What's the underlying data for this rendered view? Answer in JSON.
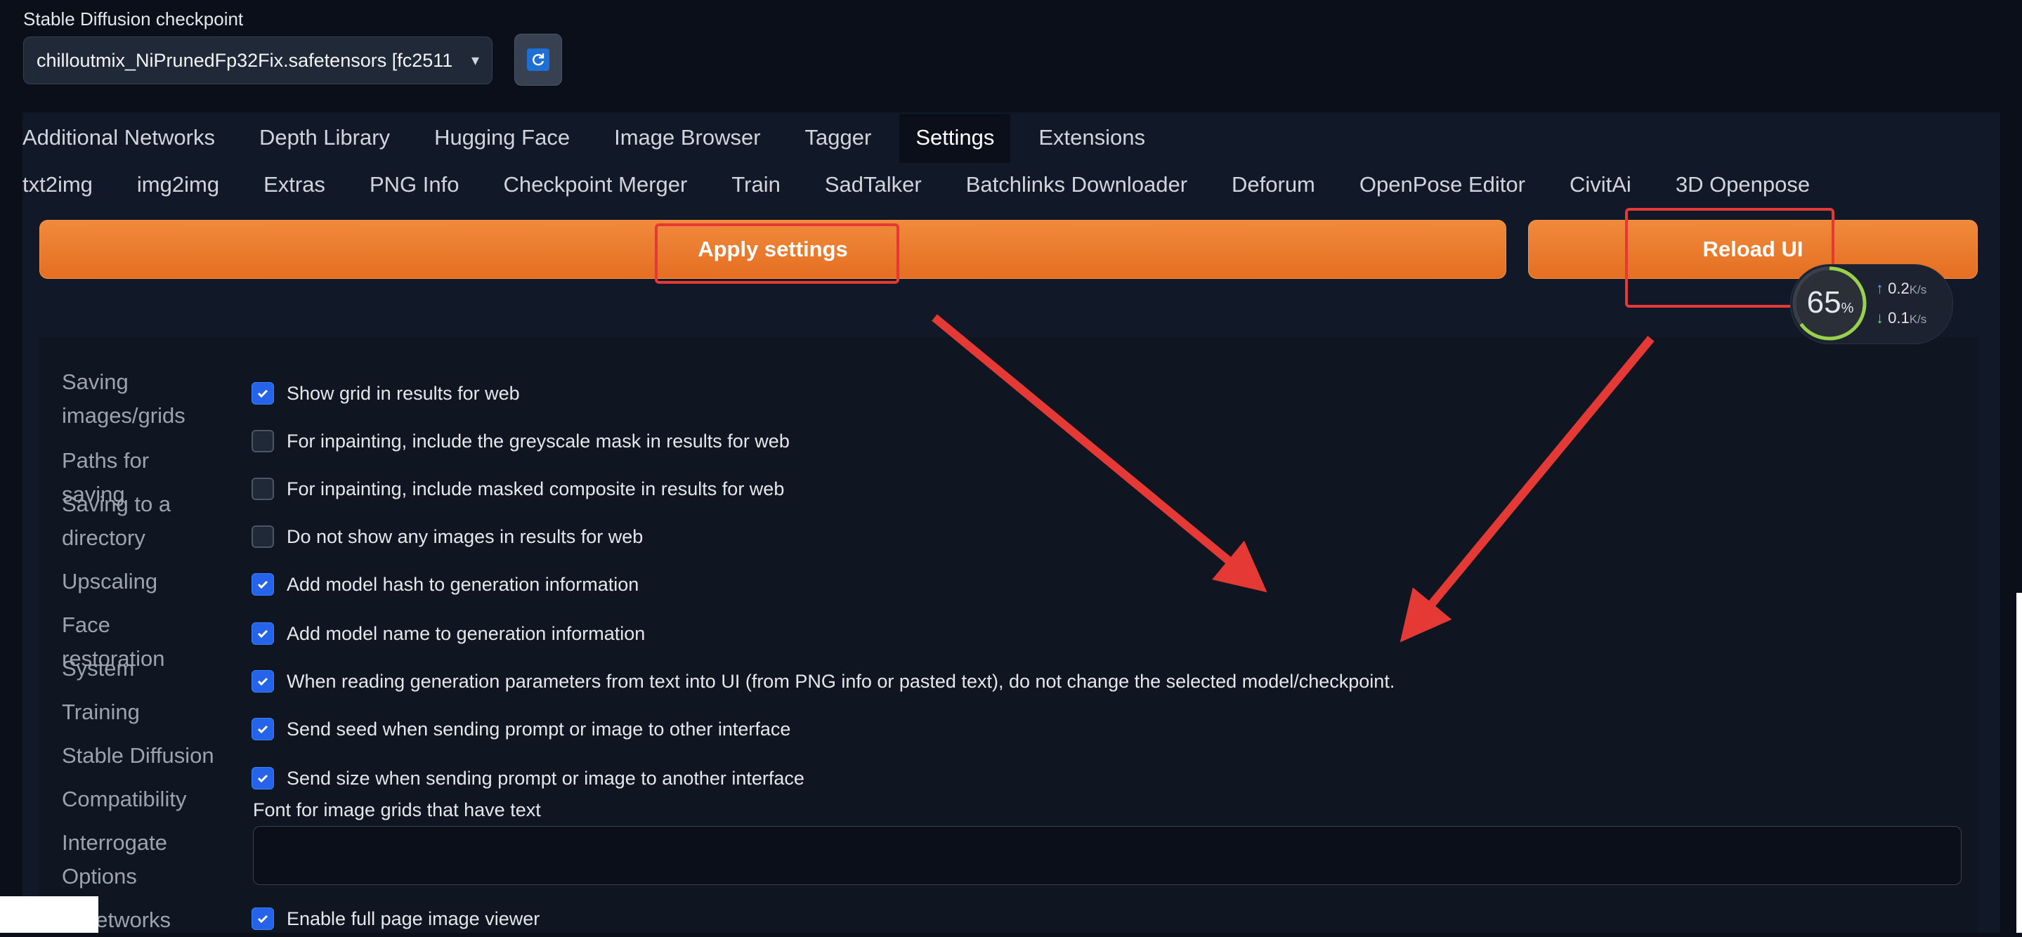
{
  "checkpoint": {
    "label": "Stable Diffusion checkpoint",
    "value": "chilloutmix_NiPrunedFp32Fix.safetensors [fc2511"
  },
  "tabs_row1": [
    "Additional Networks",
    "Depth Library",
    "Hugging Face",
    "Image Browser",
    "Tagger",
    "Settings",
    "Extensions"
  ],
  "tabs_row2": [
    "txt2img",
    "img2img",
    "Extras",
    "PNG Info",
    "Checkpoint Merger",
    "Train",
    "SadTalker",
    "Batchlinks Downloader",
    "Deforum",
    "OpenPose Editor",
    "CivitAi",
    "3D Openpose"
  ],
  "active_tab": "Settings",
  "buttons": {
    "apply": "Apply settings",
    "reload": "Reload UI"
  },
  "sidebar": [
    "Saving images/grids",
    "Paths for saving",
    "Saving to a directory",
    "Upscaling",
    "Face restoration",
    "System",
    "Training",
    "Stable Diffusion",
    "Compatibility",
    "Interrogate Options",
    "a Networks"
  ],
  "options": [
    {
      "label": "Show grid in results for web",
      "checked": true
    },
    {
      "label": "For inpainting, include the greyscale mask in results for web",
      "checked": false
    },
    {
      "label": "For inpainting, include masked composite in results for web",
      "checked": false
    },
    {
      "label": "Do not show any images in results for web",
      "checked": false
    },
    {
      "label": "Add model hash to generation information",
      "checked": true
    },
    {
      "label": "Add model name to generation information",
      "checked": true
    },
    {
      "label": "When reading generation parameters from text into UI (from PNG info or pasted text), do not change the selected model/checkpoint.",
      "checked": true
    },
    {
      "label": "Send seed when sending prompt or image to other interface",
      "checked": true
    },
    {
      "label": "Send size when sending prompt or image to another interface",
      "checked": true
    }
  ],
  "font_field": {
    "label": "Font for image grids that have text",
    "value": ""
  },
  "last_option": {
    "label": "Enable full page image viewer",
    "checked": true
  },
  "widget": {
    "percent": "65",
    "percent_unit": "%",
    "up": "0.2",
    "down": "0.1",
    "unit": "K/s"
  },
  "colors": {
    "accent_orange": "#e97a2e",
    "checkbox_blue": "#2563eb",
    "annotation_red": "#e53935"
  }
}
